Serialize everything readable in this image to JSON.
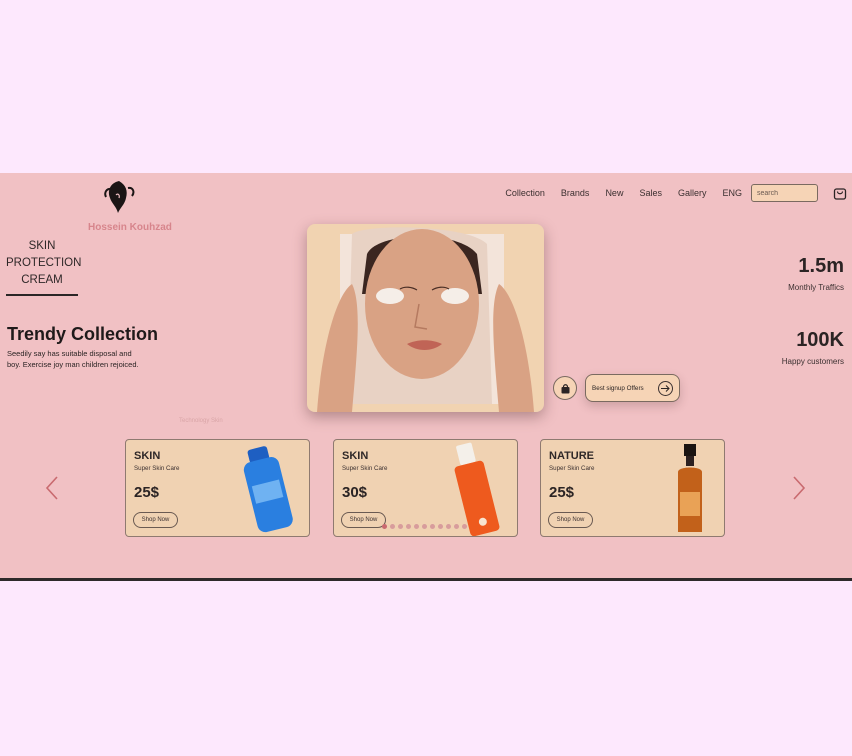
{
  "brand": {
    "name": "Hossein Kouhzad"
  },
  "nav": {
    "items": [
      "Collection",
      "Brands",
      "New",
      "Sales",
      "Gallery",
      "ENG"
    ]
  },
  "search": {
    "placeholder": "search"
  },
  "hero": {
    "skin_title": "SKIN PROTECTION CREAM",
    "collection_title": "Trendy Collection",
    "collection_desc": "Seedily say has suitable disposal and boy. Exercise joy man children rejoiced.",
    "ghost_text": "Technology Skin"
  },
  "stats": [
    {
      "value": "1.5m",
      "label": "Monthly Traffics"
    },
    {
      "value": "100K",
      "label": "Happy customers"
    }
  ],
  "offer": {
    "label": "Best signup Offers"
  },
  "cards": [
    {
      "title": "SKIN",
      "subtitle": "Super Skin Care",
      "price": "25$",
      "button": "Shop Now",
      "bottle_color": "#2a7fe0"
    },
    {
      "title": "SKIN",
      "subtitle": "Super Skin Care",
      "price": "30$",
      "button": "Shop Now",
      "bottle_color": "#ee5a1e"
    },
    {
      "title": "NATURE",
      "subtitle": "Super Skin Care",
      "price": "25$",
      "button": "Shop Now",
      "bottle_color": "#c2611a"
    }
  ],
  "carousel": {
    "dot_count": 11,
    "active_index": 0
  },
  "colors": {
    "page_bg": "#fde8fd",
    "stage_bg": "#f1c1c4",
    "card_bg": "#f0d2b2",
    "brand": "#d7858c",
    "accent": "#c96a6f"
  }
}
